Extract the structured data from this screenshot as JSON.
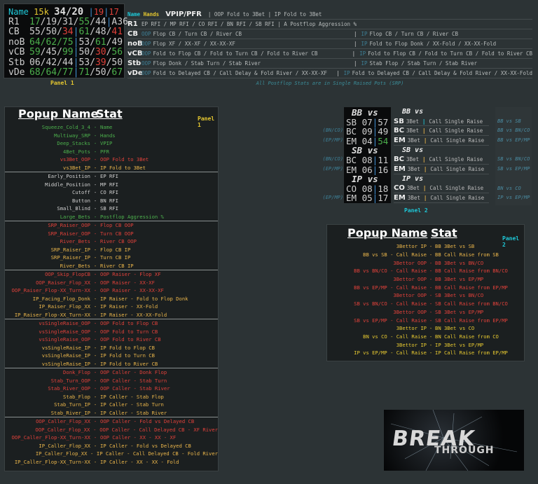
{
  "hud1": {
    "header": {
      "name": "Name",
      "hands": "15k",
      "vpip_pfr": "34/20",
      "f3_oop": "19",
      "f3_ip": "17"
    },
    "rows": [
      {
        "label": "R1",
        "cells": [
          [
            "17",
            "g"
          ],
          [
            "/",
            "w"
          ],
          [
            "19",
            "w"
          ],
          [
            "/",
            "w"
          ],
          [
            "31",
            "w"
          ],
          [
            "/",
            "w"
          ],
          [
            "55",
            "g"
          ],
          [
            "/",
            "w"
          ],
          [
            "44",
            "w"
          ]
        ],
        "tail": "A36"
      },
      {
        "label": "CB",
        "cells": [
          [
            "55",
            "w"
          ],
          [
            "/",
            "w"
          ],
          [
            "50",
            "w"
          ],
          [
            "/",
            "w"
          ],
          [
            "34",
            "r"
          ]
        ],
        "right": [
          [
            "61",
            "g"
          ],
          [
            "/",
            "w"
          ],
          [
            "48",
            "w"
          ],
          [
            "/",
            "w"
          ],
          [
            "41",
            "r"
          ]
        ]
      },
      {
        "label": "noB",
        "cells": [
          [
            "64",
            "g"
          ],
          [
            "/",
            "g"
          ],
          [
            "62",
            "g"
          ],
          [
            "/",
            "g"
          ],
          [
            "75",
            "g"
          ]
        ],
        "right": [
          [
            "53",
            "w"
          ],
          [
            "/",
            "w"
          ],
          [
            "61",
            "g"
          ],
          [
            "/",
            "w"
          ],
          [
            "49",
            "w"
          ]
        ]
      },
      {
        "label": "vCB",
        "cells": [
          [
            "59",
            "g"
          ],
          [
            "/",
            "w"
          ],
          [
            "45",
            "w"
          ],
          [
            "/",
            "w"
          ],
          [
            "99",
            "g"
          ]
        ],
        "right": [
          [
            "50",
            "w"
          ],
          [
            "/",
            "w"
          ],
          [
            "30",
            "r"
          ],
          [
            "/",
            "w"
          ],
          [
            "56",
            "g"
          ]
        ]
      },
      {
        "label": "Stb",
        "cells": [
          [
            "06",
            "w"
          ],
          [
            "/",
            "w"
          ],
          [
            "42",
            "w"
          ],
          [
            "/",
            "w"
          ],
          [
            "44",
            "w"
          ]
        ],
        "right": [
          [
            "53",
            "w"
          ],
          [
            "/",
            "w"
          ],
          [
            "39",
            "r"
          ],
          [
            "/",
            "w"
          ],
          [
            "50",
            "w"
          ]
        ]
      },
      {
        "label": "vDe",
        "cells": [
          [
            "68",
            "g"
          ],
          [
            "/",
            "g"
          ],
          [
            "64",
            "g"
          ],
          [
            "/",
            "g"
          ],
          [
            "77",
            "g"
          ]
        ],
        "right": [
          [
            "71",
            "g"
          ],
          [
            "/",
            "w"
          ],
          [
            "50",
            "w"
          ],
          [
            "/",
            "w"
          ],
          [
            "67",
            "g"
          ]
        ]
      }
    ],
    "panel_label": "Panel 1"
  },
  "legend": {
    "hdr": {
      "name": "Name",
      "hands": "Hands",
      "vpip": "VPIP/PFR",
      "rest": "| OOP Fold to 3Bet  |  IP Fold to 3Bet"
    },
    "r1": {
      "label": "R1",
      "text": "EP RFI / MP RFI / CO RFI / BN RFI / SB RFI   |   A Postflop Aggression %"
    },
    "rows": [
      {
        "label": "CB",
        "oop": "OOP",
        "l": "Flop CB / Turn CB / River CB",
        "ip": "IP",
        "r": "Flop CB / Turn CB / River CB"
      },
      {
        "label": "noB",
        "oop": "OOP",
        "l": "Flop XF / XX-XF / XX-XX-XF",
        "ip": "IP",
        "r": "Fold to Flop Donk / XX-Fold / XX-XX-Fold"
      },
      {
        "label": "vCB",
        "oop": "OOP",
        "l": "Fold to Flop CB / Fold to Turn CB / Fold to River CB",
        "ip": "IP",
        "r": "Fold to Flop CB / Fold to Turn CB / Fold to River CB"
      },
      {
        "label": "Stb",
        "oop": "OOP",
        "l": "Flop Donk / Stab Turn / Stab River",
        "ip": "IP",
        "r": "Stab Flop / Stab Turn / Stab River"
      },
      {
        "label": "vDe",
        "oop": "OOP",
        "l": "Fold to Delayed CB / Call Delay & Fold River / XX-XX-XF",
        "ip": "IP",
        "r": "Fold to Delayed CB / Call Delay & Fold River / XX-XX-Fold"
      }
    ],
    "note": "All Postflop Stats are in Single Raised Pots (SRP)"
  },
  "popup1": {
    "title_name": "Popup Name",
    "title_stat": "Stat",
    "panel": "Panel 1",
    "groups": [
      [
        [
          "Squeeze_Cold_3_4",
          "Name",
          "g"
        ],
        [
          "Multiway_SRP",
          "Hands",
          "g"
        ],
        [
          "Deep_Stacks",
          "VPIP",
          "g"
        ],
        [
          "4Bet_Pots",
          "PFR",
          "g"
        ],
        [
          "vs3Bet_OOP",
          "OOP Fold to 3Bet",
          "r"
        ],
        [
          "vs3Bet_IP",
          "IP Fold to 3Bet",
          "o"
        ]
      ],
      [
        [
          "Early_Position",
          "EP RFI",
          "w"
        ],
        [
          "Middle_Position",
          "MP RFI",
          "w"
        ],
        [
          "Cutoff",
          "CO RFI",
          "w"
        ],
        [
          "Button",
          "BN RFI",
          "w"
        ],
        [
          "Small_Blind",
          "SB RFI",
          "w"
        ],
        [
          "Large_Bets",
          "Postflop Aggression %",
          "g"
        ]
      ],
      [
        [
          "SRP_Raiser_OOP",
          "Flop CB OOP",
          "r"
        ],
        [
          "SRP_Raiser_OOP",
          "Turn CB OOP",
          "r"
        ],
        [
          "River_Bets",
          "River CB OOP",
          "r"
        ],
        [
          "SRP_Raiser_IP",
          "Flop CB IP",
          "o"
        ],
        [
          "SRP_Raiser_IP",
          "Turn CB IP",
          "o"
        ],
        [
          "River_Bets",
          "River CB IP",
          "o"
        ]
      ],
      [
        [
          "OOP_Skip_FlopCB",
          "OOP Raiser - Flop XF",
          "r"
        ],
        [
          "OOP_Raiser_Flop_XX",
          "OOP Raiser - XX-XF",
          "r"
        ],
        [
          "OOP_Raiser_Flop-XX_Turn-XX",
          "OOP Raiser - XX-XX-XF",
          "r"
        ],
        [
          "IP_Facing_Flop_Donk",
          "IP Raiser - Fold to Flop Donk",
          "o"
        ],
        [
          "IP_Raiser_Flop_XX",
          "IP Raiser - XX-Fold",
          "o"
        ],
        [
          "IP_Raiser_Flop-XX_Turn-XX",
          "IP Raiser - XX-XX-Fold",
          "o"
        ]
      ],
      [
        [
          "vsSingleRaise_OOP",
          "OOP Fold to Flop CB",
          "r"
        ],
        [
          "vsSingleRaise_OOP",
          "OOP Fold to Turn CB",
          "r"
        ],
        [
          "vsSingleRaise_OOP",
          "OOP Fold to River CB",
          "r"
        ],
        [
          "vsSingleRaise_IP",
          "IP Fold to Flop CB",
          "o"
        ],
        [
          "vsSingleRaise_IP",
          "IP Fold to Turn CB",
          "o"
        ],
        [
          "vsSingleRaise_IP",
          "IP Fold to River CB",
          "o"
        ]
      ],
      [
        [
          "Donk_Flop",
          "OOP Caller - Donk Flop",
          "r"
        ],
        [
          "Stab_Turn_OOP",
          "OOP Caller - Stab Turn",
          "r"
        ],
        [
          "Stab_River_OOP",
          "OOP Caller - Stab River",
          "r"
        ],
        [
          "Stab_Flop",
          "IP Caller - Stab Flop",
          "o"
        ],
        [
          "Stab_Turn_IP",
          "IP Caller - Stab Turn",
          "o"
        ],
        [
          "Stab_River_IP",
          "IP Caller - Stab River",
          "o"
        ]
      ],
      [
        [
          "OOP_Caller_Flop_XX",
          "OOP Caller - Fold vs Delayed CB",
          "r"
        ],
        [
          "OOP_Caller_Flop_XX",
          "OOP Caller - Call Delayed CB - XF River",
          "r"
        ],
        [
          "OOP_Caller_Flop-XX_Turn-XX",
          "OOP Caller - XX - XX - XF",
          "r"
        ],
        [
          "IP_Caller_Flop_XX",
          "IP Caller - Fold vs Delayed CB",
          "o"
        ],
        [
          "IP_Caller_Flop_XX",
          "IP Caller - Call Delayed CB - Fold River",
          "o"
        ],
        [
          "IP_Caller_Flop-XX_Turn-XX",
          "IP Caller - XX - XX - Fold",
          "o"
        ]
      ]
    ]
  },
  "hud2": {
    "items": [
      {
        "type": "h",
        "text": "BB vs",
        "legend": "BB vs"
      },
      {
        "pos": "SB",
        "a": "07",
        "b": "57",
        "bc": "w",
        "side": "",
        "text": "3Bet",
        "sepc": "c",
        "call": "Call Single Raise",
        "right": "BB vs SB"
      },
      {
        "pos": "BC",
        "a": "09",
        "b": "49",
        "bc": "w",
        "side": "(BN/CO)",
        "text": "3Bet",
        "sepc": "o",
        "call": "Call Single Raise",
        "right": "BB vs BN/CO"
      },
      {
        "pos": "EM",
        "a": "04",
        "b": "54",
        "bc": "g",
        "side": "(EP/MP)",
        "text": "3Bet",
        "sepc": "o",
        "call": "Call Single Raise",
        "right": "BB vs EP/MP"
      },
      {
        "type": "h",
        "text": "SB vs",
        "legend": "SB vs"
      },
      {
        "pos": "BC",
        "a": "08",
        "b": "11",
        "bc": "w",
        "side": "(BN/CO)",
        "text": "3Bet",
        "sepc": "o",
        "call": "Call Single Raise",
        "right": "SB vs BN/CO"
      },
      {
        "pos": "EM",
        "a": "06",
        "b": "16",
        "bc": "w",
        "side": "(EP/MP)",
        "text": "3Bet",
        "sepc": "o",
        "call": "Call Single Raise",
        "right": "SB vs EP/MP"
      },
      {
        "type": "h",
        "text": "IP vs",
        "legend": "IP vs"
      },
      {
        "pos": "CO",
        "a": "08",
        "b": "18",
        "bc": "w",
        "side": "",
        "text": "3Bet",
        "sepc": "o",
        "call": "Call Single Raise",
        "right": "BN vs CO"
      },
      {
        "pos": "EM",
        "a": "05",
        "b": "17",
        "bc": "w",
        "side": "(EP/MP)",
        "text": "3Bet",
        "sepc": "o",
        "call": "Call Single Raise",
        "right": "IP vs EP/MP"
      }
    ],
    "panel_label": "Panel 2"
  },
  "popup2": {
    "title_name": "Popup Name",
    "title_stat": "Stat",
    "panel": "Panel 2",
    "rows": [
      [
        "3Bettor IP",
        "BB 3Bet vs SB",
        "o"
      ],
      [
        "BB vs SB - Call Raise",
        "BB Call Raise from SB",
        "o"
      ],
      [
        "3Bettor OOP",
        "BB 3Bet vs BN/CO",
        "r"
      ],
      [
        "BB vs BN/CO - Call Raise",
        "BB Call Raise from BN/CO",
        "r"
      ],
      [
        "3Bettor OOP",
        "BB 3Bet vs EP/MP",
        "r"
      ],
      [
        "BB vs EP/MP - Call Raise",
        "BB Call Raise from EP/MP",
        "r"
      ],
      [
        "3Bettor OOP",
        "SB 3Bet vs BN/CO",
        "r"
      ],
      [
        "SB vs BN/CO - Call Raise",
        "SB Call Raise from BN/CO",
        "r"
      ],
      [
        "3Bettor OOP",
        "SB 3Bet vs EP/MP",
        "r"
      ],
      [
        "SB vs EP/MP - Call Raise",
        "SB Call Raise from EP/MP",
        "r"
      ],
      [
        "3Bettor IP",
        "BN 3Bet vs CO",
        "y"
      ],
      [
        "BN vs CO - Call Raise",
        "BN Call Raise from CO",
        "y"
      ],
      [
        "3Bettor IP",
        "IP 3Bet vs EP/MP",
        "y"
      ],
      [
        "IP vs EP/MP - Call Raise",
        "IP Call Raise from EP/MP",
        "y"
      ]
    ]
  },
  "logo": {
    "line1": "BREAK",
    "line2": "THROUGH"
  }
}
